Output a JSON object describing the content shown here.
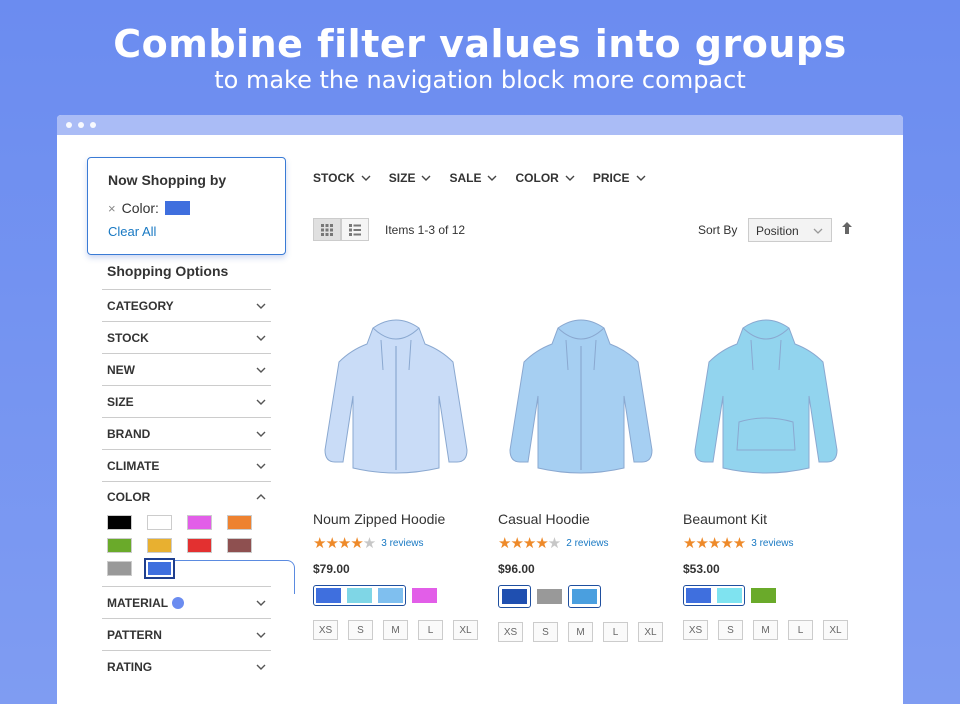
{
  "hero": {
    "title": "Combine filter values into groups",
    "subtitle": "to make the navigation block more compact"
  },
  "now_shopping": {
    "title": "Now Shopping by",
    "remove": "×",
    "filter_label": "Color:",
    "filter_color": "#3f6fde",
    "clear_all": "Clear All"
  },
  "sidebar": {
    "title": "Shopping Options",
    "filters": [
      {
        "label": "CATEGORY",
        "expanded": false
      },
      {
        "label": "STOCK",
        "expanded": false
      },
      {
        "label": "NEW",
        "expanded": false
      },
      {
        "label": "SIZE",
        "expanded": false
      },
      {
        "label": "BRAND",
        "expanded": false
      },
      {
        "label": "CLIMATE",
        "expanded": false
      },
      {
        "label": "COLOR",
        "expanded": true
      },
      {
        "label": "MATERIAL",
        "expanded": false
      },
      {
        "label": "PATTERN",
        "expanded": false
      },
      {
        "label": "RATING",
        "expanded": false
      }
    ],
    "color_swatches": [
      "#000000",
      "#ffffff",
      "#e25ee8",
      "#ee8230",
      "#6aaa2a",
      "#e8b030",
      "#e33030",
      "#8e5050",
      "#999999",
      "#3f6fde"
    ],
    "selected_swatch_index": 9
  },
  "top_filters": [
    "STOCK",
    "SIZE",
    "SALE",
    "COLOR",
    "PRICE"
  ],
  "toolbar": {
    "items_count": "Items 1-3 of 12",
    "sort_label": "Sort By",
    "sort_value": "Position"
  },
  "products": [
    {
      "name": "Noum Zipped Hoodie",
      "stars": 4,
      "reviews": "3 reviews",
      "price": "$79.00",
      "group": [
        "#3f6fde",
        "#7fd6e6",
        "#7fbfef"
      ],
      "extra": [
        "#e25ee8"
      ],
      "hoodie_color": "#c9dcf7"
    },
    {
      "name": "Casual Hoodie",
      "stars": 4,
      "reviews": "2 reviews",
      "price": "$96.00",
      "group_single_a": "#1f4fb0",
      "extra": [
        "#999999"
      ],
      "group_single_b": "#4a9fdf",
      "hoodie_color": "#a6cff2"
    },
    {
      "name": "Beaumont Kit",
      "stars": 5,
      "reviews": "3 reviews",
      "price": "$53.00",
      "group": [
        "#3f6fde",
        "#7fe3f0"
      ],
      "extra": [
        "#6aaa2a"
      ],
      "hoodie_color": "#92d4ee"
    }
  ],
  "sizes": [
    "XS",
    "S",
    "M",
    "L",
    "XL"
  ],
  "colors": {
    "accent": "#1979c3",
    "star": "#ee8a2a",
    "background": "#6b8cf0"
  }
}
